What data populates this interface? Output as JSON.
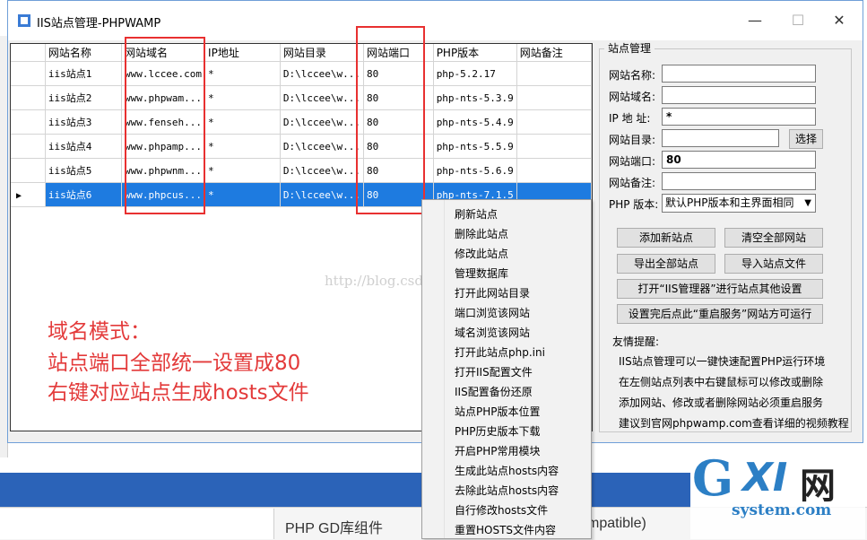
{
  "window": {
    "title": "IIS站点管理-PHPWAMP",
    "minimize": "—",
    "maximize": "☐",
    "close": "✕"
  },
  "grid": {
    "columns": [
      "网站名称",
      "网站域名",
      "IP地址",
      "网站目录",
      "网站端口",
      "PHP版本",
      "网站备注"
    ],
    "rows": [
      [
        "iis站点1",
        "www.lccee.com",
        "*",
        "D:\\lccee\\w...",
        "80",
        "php-5.2.17",
        ""
      ],
      [
        "iis站点2",
        "www.phpwam...",
        "*",
        "D:\\lccee\\w...",
        "80",
        "php-nts-5.3.9",
        ""
      ],
      [
        "iis站点3",
        "www.fenseh...",
        "*",
        "D:\\lccee\\w...",
        "80",
        "php-nts-5.4.9",
        ""
      ],
      [
        "iis站点4",
        "www.phpamp...",
        "*",
        "D:\\lccee\\w...",
        "80",
        "php-nts-5.5.9",
        ""
      ],
      [
        "iis站点5",
        "www.phpwnm...",
        "*",
        "D:\\lccee\\w...",
        "80",
        "php-nts-5.6.9",
        ""
      ],
      [
        "iis站点6",
        "www.phpcus...",
        "*",
        "D:\\lccee\\w...",
        "80",
        "php-nts-7.1.5",
        ""
      ]
    ],
    "selected_row": 5,
    "watermark": "http://blog.csdn.net/lccee"
  },
  "annotation": {
    "line1": "域名模式：",
    "line2": "站点端口全部统一设置成80",
    "line3": "右键对应站点生成hosts文件"
  },
  "panel": {
    "title": "站点管理",
    "fields": [
      {
        "label": "网站名称:",
        "value": ""
      },
      {
        "label": "网站域名:",
        "value": ""
      },
      {
        "label": "IP 地 址:",
        "value": "*"
      },
      {
        "label": "网站目录:",
        "value": ""
      },
      {
        "label": "网站端口:",
        "value": "80"
      },
      {
        "label": "网站备注:",
        "value": ""
      }
    ],
    "browse_button": "选择",
    "php_label": "PHP 版本:",
    "php_select": "默认PHP版本和主界面相同",
    "buttons": {
      "add": "添加新站点",
      "clear": "清空全部网站",
      "export": "导出全部站点",
      "import": "导入站点文件",
      "open_iis": "打开“IIS管理器”进行站点其他设置",
      "restart_hint": "设置完后点此“重启服务”网站方可运行"
    },
    "tips_title": "友情提醒:",
    "tips": [
      "IIS站点管理可以一键快速配置PHP运行环境",
      "在左侧站点列表中右键鼠标可以修改或删除",
      "添加网站、修改或者删除网站必须重启服务",
      "建议到官网phpwamp.com查看详细的视频教程"
    ]
  },
  "context_menu": [
    "刷新站点",
    "删除此站点",
    "修改此站点",
    "管理数据库",
    "打开此网站目录",
    "端口浏览该网站",
    "域名浏览该网站",
    "打开此站点php.ini",
    "打开IIS配置文件",
    "IIS配置备份还原",
    "站点PHP版本位置",
    "PHP历史版本下载",
    "开启PHP常用模块",
    "生成此站点hosts内容",
    "去除此站点hosts内容",
    "自行修改hosts文件",
    "重置HOSTS文件内容"
  ],
  "background": {
    "bottom_left": "PHP GD库组件",
    "bottom_mid": "mpatible)"
  },
  "logo": {
    "g": "G",
    "xi": "XI",
    "wang": "网",
    "system": "system.com"
  },
  "colors": {
    "selection": "#1e7be0",
    "annotation_red": "#e33a3a",
    "logo_blue": "#2c7fc5"
  }
}
